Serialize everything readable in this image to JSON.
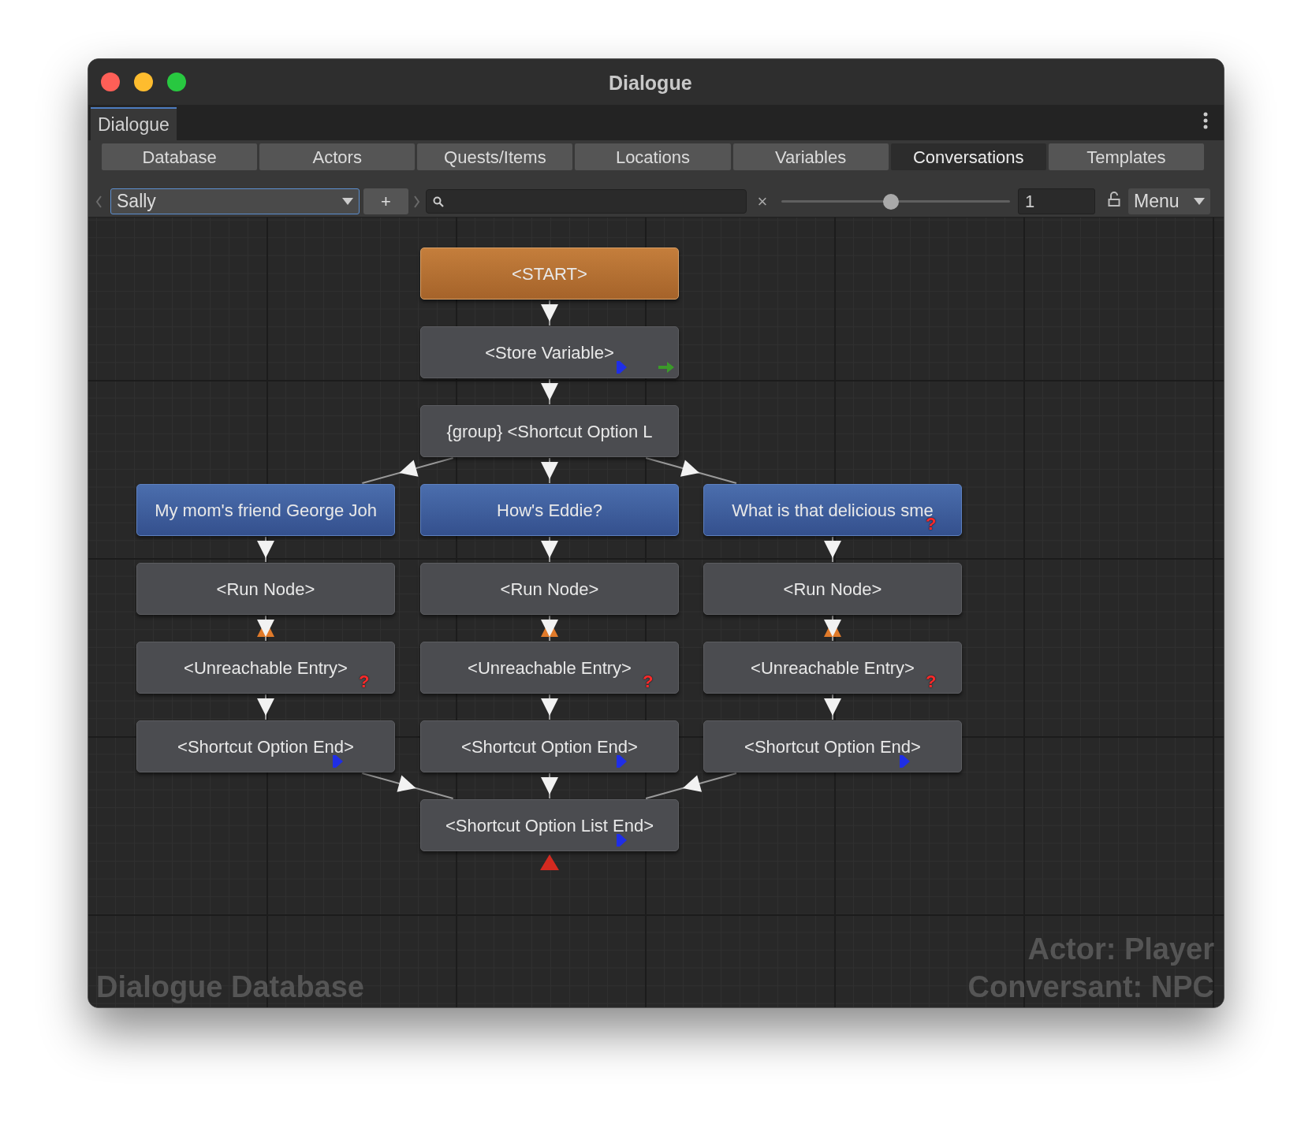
{
  "window": {
    "title": "Dialogue"
  },
  "panel_tab": {
    "label": "Dialogue",
    "selected": true
  },
  "tabs": [
    {
      "label": "Database",
      "selected": false
    },
    {
      "label": "Actors",
      "selected": false
    },
    {
      "label": "Quests/Items",
      "selected": false
    },
    {
      "label": "Locations",
      "selected": false
    },
    {
      "label": "Variables",
      "selected": false
    },
    {
      "label": "Conversations",
      "selected": true
    },
    {
      "label": "Templates",
      "selected": false
    }
  ],
  "toolbar": {
    "conversation": "Sally",
    "add": "+",
    "clear": "×",
    "zoom": {
      "level": 0.48
    },
    "node_field": "1",
    "menu": "Menu"
  },
  "nodes": [
    {
      "kind": "start",
      "label": "<START>"
    },
    {
      "kind": "normal",
      "label": "<Store Variable>",
      "badges": [
        {
          "kind": "script"
        },
        {
          "kind": "sequence"
        }
      ]
    },
    {
      "kind": "normal",
      "label": "{group} <Shortcut Option L"
    },
    {
      "kind": "response",
      "label": "My mom's friend George Joh"
    },
    {
      "kind": "response",
      "label": "How's Eddie?"
    },
    {
      "kind": "response",
      "label": "What is that delicious sme",
      "badges": [
        {
          "kind": "condition",
          "symbol": "?"
        }
      ]
    },
    {
      "kind": "normal",
      "label": "<Run Node>"
    },
    {
      "kind": "normal",
      "label": "<Run Node>"
    },
    {
      "kind": "normal",
      "label": "<Run Node>"
    },
    {
      "kind": "normal",
      "label": "<Unreachable Entry>",
      "unreachable": true,
      "badges": [
        {
          "kind": "condition",
          "symbol": "?"
        }
      ]
    },
    {
      "kind": "normal",
      "label": "<Unreachable Entry>",
      "unreachable": true,
      "badges": [
        {
          "kind": "condition",
          "symbol": "?"
        }
      ]
    },
    {
      "kind": "normal",
      "label": "<Unreachable Entry>",
      "unreachable": true,
      "badges": [
        {
          "kind": "condition",
          "symbol": "?"
        }
      ]
    },
    {
      "kind": "normal",
      "label": "<Shortcut Option End>",
      "badges": [
        {
          "kind": "script"
        }
      ]
    },
    {
      "kind": "normal",
      "label": "<Shortcut Option End>",
      "badges": [
        {
          "kind": "script"
        }
      ]
    },
    {
      "kind": "normal",
      "label": "<Shortcut Option End>",
      "badges": [
        {
          "kind": "script"
        }
      ]
    },
    {
      "kind": "normal",
      "label": "<Shortcut Option List End>",
      "badges": [
        {
          "kind": "script"
        },
        {
          "kind": "end"
        }
      ]
    }
  ],
  "overlay": {
    "database": "Dialogue Database",
    "actor": "Actor: Player",
    "conversant": "Conversant: NPC"
  }
}
